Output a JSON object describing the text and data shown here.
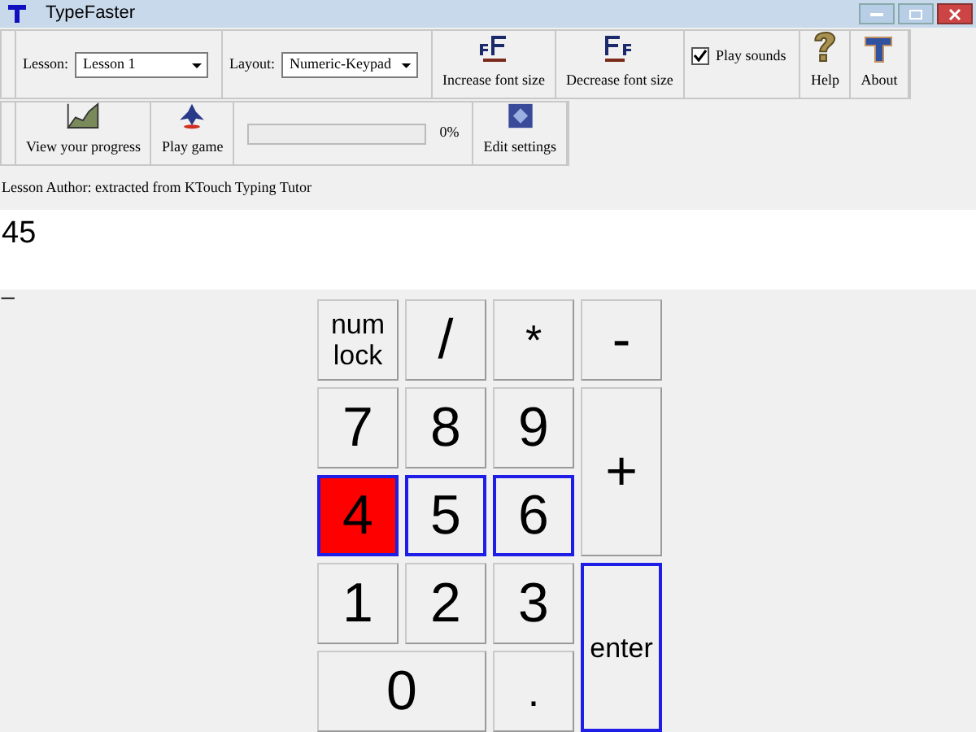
{
  "window": {
    "title": "TypeFaster"
  },
  "toolbar": {
    "lesson_label": "Lesson:",
    "lesson_value": "Lesson 1",
    "layout_label": "Layout:",
    "layout_value": "Numeric-Keypad",
    "increase_font": "Increase font size",
    "decrease_font": "Decrease font size",
    "play_sounds": {
      "label": "Play sounds",
      "checked": true
    },
    "help": "Help",
    "about": "About"
  },
  "toolbar2": {
    "view_progress": "View your progress",
    "play_game": "Play game",
    "progress_reading": "0%",
    "edit_settings": "Edit settings"
  },
  "lesson_author": "Lesson Author: extracted from KTouch Typing Tutor",
  "typing": {
    "text": "45",
    "cursor": "_"
  },
  "keys": [
    {
      "label": "num lock",
      "highlighted": false,
      "outlined": false
    },
    {
      "label": "/",
      "highlighted": false,
      "outlined": false
    },
    {
      "label": "*",
      "highlighted": false,
      "outlined": false
    },
    {
      "label": "-",
      "highlighted": false,
      "outlined": false
    },
    {
      "label": "7",
      "highlighted": false,
      "outlined": false
    },
    {
      "label": "8",
      "highlighted": false,
      "outlined": false
    },
    {
      "label": "9",
      "highlighted": false,
      "outlined": false
    },
    {
      "label": "+",
      "highlighted": false,
      "outlined": false
    },
    {
      "label": "4",
      "highlighted": true,
      "outlined": true
    },
    {
      "label": "5",
      "highlighted": false,
      "outlined": true
    },
    {
      "label": "6",
      "highlighted": false,
      "outlined": true
    },
    {
      "label": "1",
      "highlighted": false,
      "outlined": false
    },
    {
      "label": "2",
      "highlighted": false,
      "outlined": false
    },
    {
      "label": "3",
      "highlighted": false,
      "outlined": false
    },
    {
      "label": "enter",
      "highlighted": false,
      "outlined": true
    },
    {
      "label": "0",
      "highlighted": false,
      "outlined": false
    },
    {
      "label": ".",
      "highlighted": false,
      "outlined": false
    }
  ]
}
